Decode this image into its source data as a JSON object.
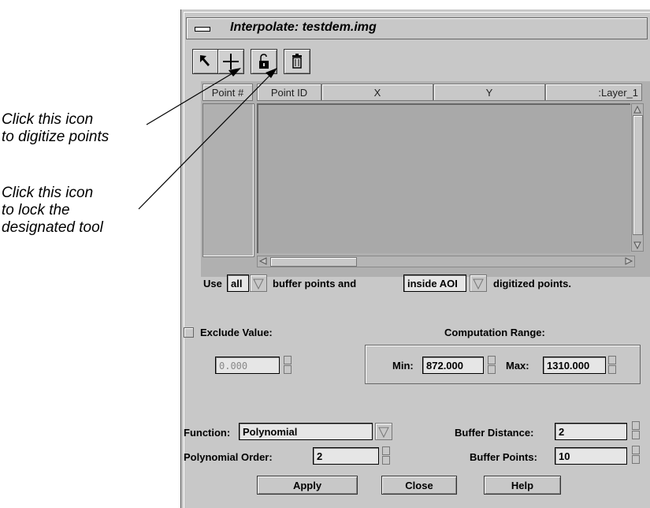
{
  "annotations": {
    "digitize": {
      "line1": "Click this icon",
      "line2": "to digitize points"
    },
    "lock": {
      "line1": "Click this icon",
      "line2": "to lock the",
      "line3": "designated tool"
    }
  },
  "window": {
    "title": "Interpolate: testdem.img"
  },
  "toolbar": {
    "icons": [
      "arrow-select-icon",
      "crosshair-digitize-icon",
      "lock-icon",
      "trash-icon"
    ]
  },
  "grid": {
    "columns": [
      "Point #",
      "Point ID",
      "X",
      "Y",
      ":Layer_1"
    ]
  },
  "use_row": {
    "prefix": "Use",
    "buffer_option": "all",
    "mid_text": "buffer points and",
    "aoi_option": "inside AOI",
    "suffix": "digitized points."
  },
  "exclude": {
    "label": "Exclude Value:",
    "value": "0.000",
    "checked": false
  },
  "computation_range": {
    "title": "Computation Range:",
    "min_label": "Min:",
    "min_value": "872.000",
    "max_label": "Max:",
    "max_value": "1310.000"
  },
  "function": {
    "label": "Function:",
    "value": "Polynomial"
  },
  "polynomial_order": {
    "label": "Polynomial Order:",
    "value": "2"
  },
  "buffer_distance": {
    "label": "Buffer Distance:",
    "value": "2"
  },
  "buffer_points": {
    "label": "Buffer Points:",
    "value": "10"
  },
  "buttons": {
    "apply": "Apply",
    "close": "Close",
    "help": "Help"
  }
}
